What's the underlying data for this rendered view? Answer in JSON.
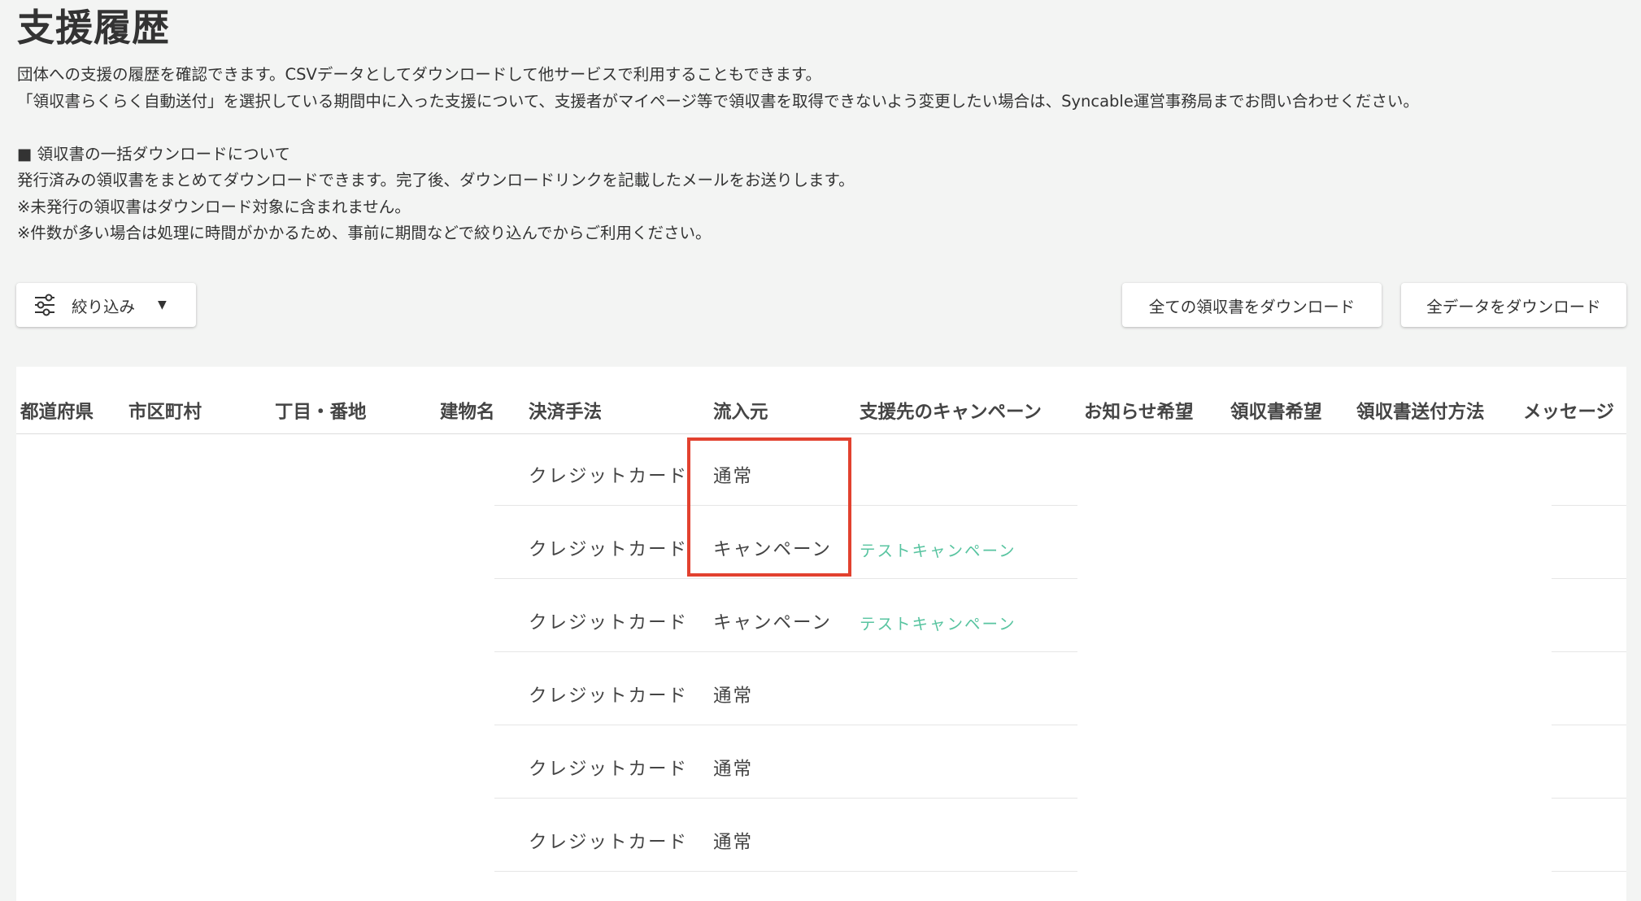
{
  "page": {
    "title": "支援履歴",
    "description": [
      "団体への支援の履歴を確認できます。CSVデータとしてダウンロードして他サービスで利用することもできます。",
      "「領収書らくらく自動送付」を選択している期間中に入った支援について、支援者がマイページ等で領収書を取得できないよう変更したい場合は、Syncable運営事務局までお問い合わせください。"
    ],
    "bulk_section": {
      "heading": "■ 領収書の一括ダウンロードについて",
      "lines": [
        "発行済みの領収書をまとめてダウンロードできます。完了後、ダウンロードリンクを記載したメールをお送りします。",
        "※未発行の領収書はダウンロード対象に含まれません。",
        "※件数が多い場合は処理に時間がかかるため、事前に期間などで絞り込んでからご利用ください。"
      ]
    }
  },
  "toolbar": {
    "filter_label": "絞り込み",
    "filter_icon": "sliders-icon",
    "dropdown_icon": "caret-down-icon",
    "download_receipts_label": "全ての領収書をダウンロード",
    "download_data_label": "全データをダウンロード"
  },
  "table": {
    "columns": [
      "都道府県",
      "市区町村",
      "丁目・番地",
      "建物名",
      "決済手法",
      "流入元",
      "支援先のキャンペーン",
      "お知らせ希望",
      "領収書希望",
      "領収書送付方法",
      "メッセージ"
    ],
    "rows": [
      {
        "payment": "クレジットカード",
        "source": "通常",
        "campaign": ""
      },
      {
        "payment": "クレジットカード",
        "source": "キャンペーン",
        "campaign": "テストキャンペーン"
      },
      {
        "payment": "クレジットカード",
        "source": "キャンペーン",
        "campaign": "テストキャンペーン"
      },
      {
        "payment": "クレジットカード",
        "source": "通常",
        "campaign": ""
      },
      {
        "payment": "クレジットカード",
        "source": "通常",
        "campaign": ""
      },
      {
        "payment": "クレジットカード",
        "source": "通常",
        "campaign": ""
      }
    ]
  },
  "colors": {
    "background": "#f3f4f3",
    "link": "#58c4a0",
    "highlight": "#e2412f"
  }
}
